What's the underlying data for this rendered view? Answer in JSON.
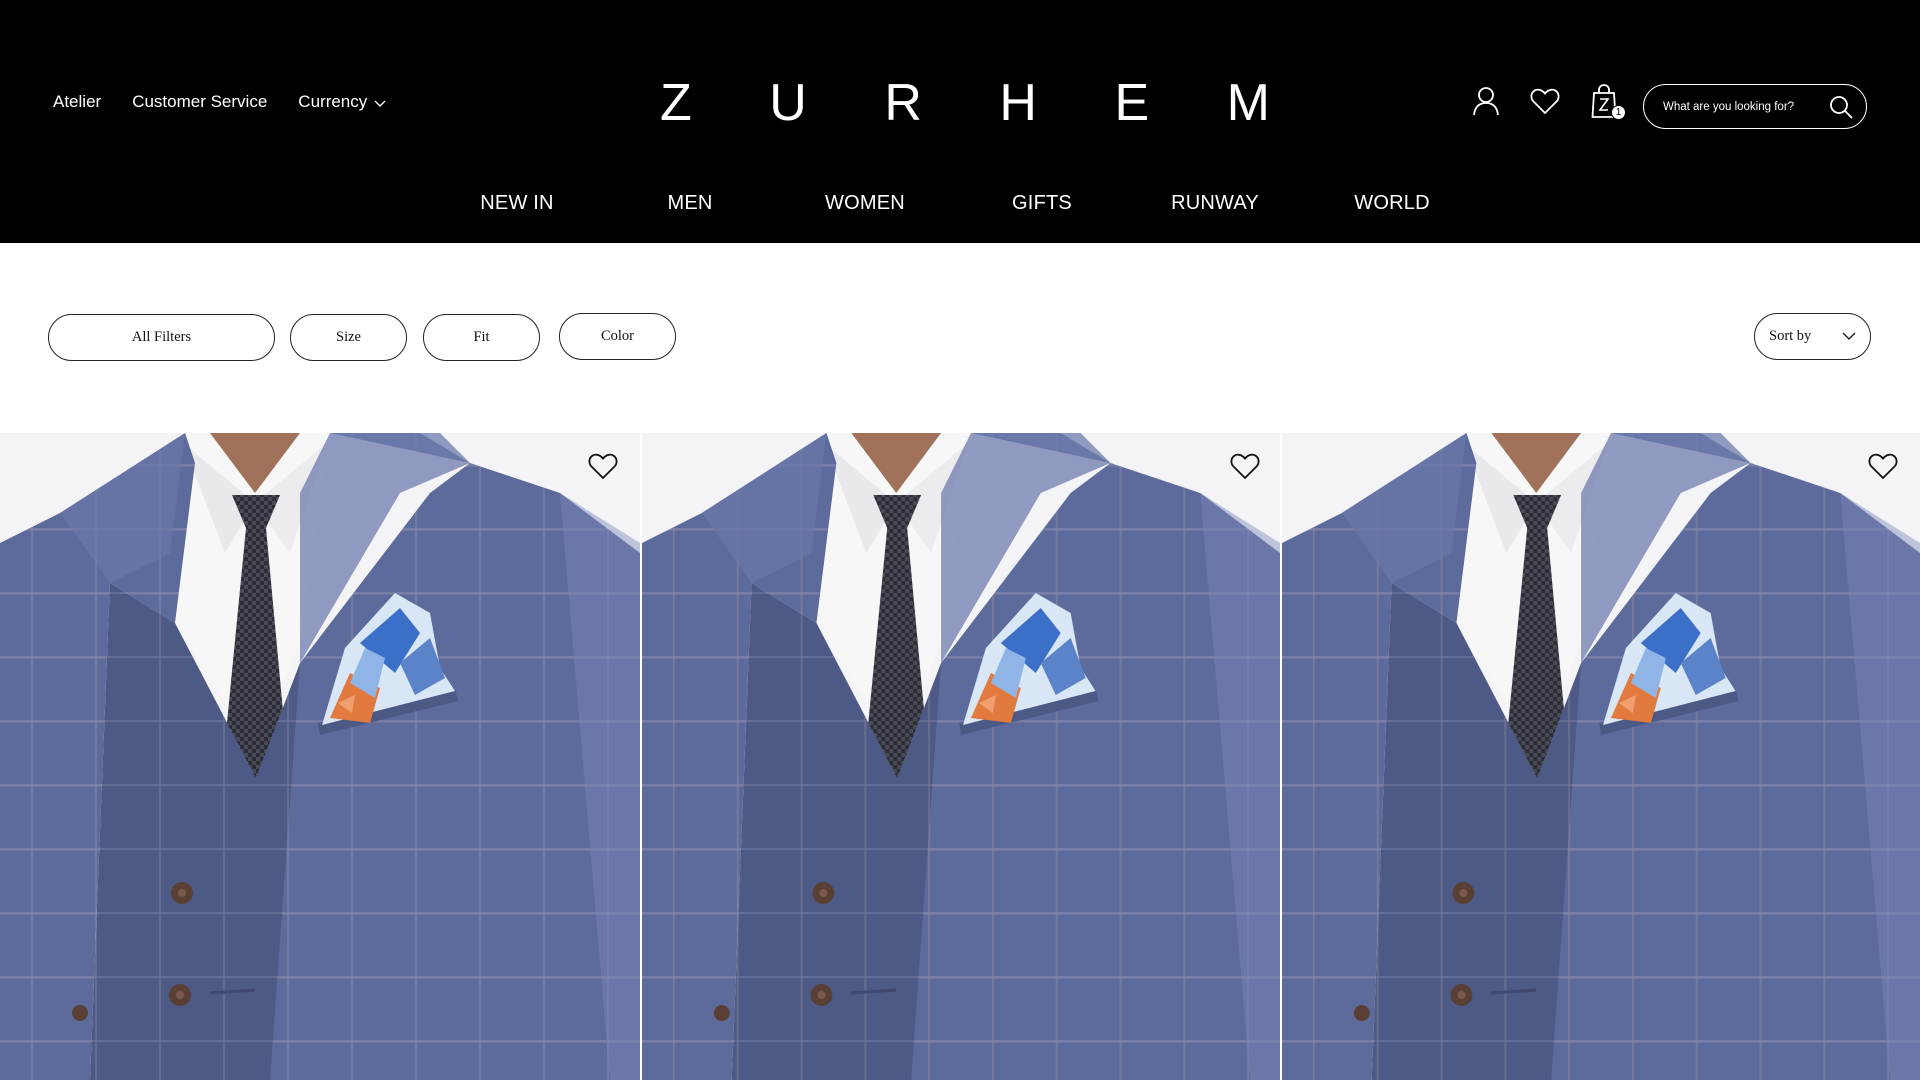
{
  "header": {
    "utility_links": [
      "Atelier",
      "Customer Service",
      "Currency"
    ],
    "logo_letters": [
      "Z",
      "U",
      "R",
      "H",
      "E",
      "M"
    ],
    "icons": {
      "account": "user-icon",
      "wishlist": "heart-icon",
      "cart": "shopping-bag-icon",
      "search": "search-icon"
    },
    "cart_count": "1",
    "search_placeholder": "What are you looking for?"
  },
  "main_nav": [
    "NEW IN",
    "MEN",
    "WOMEN",
    "GIFTS",
    "RUNWAY",
    "WORLD"
  ],
  "filters": {
    "all_filters": "All Filters",
    "size": "Size",
    "fit": "Fit",
    "color": "Color",
    "sort_by": "Sort by"
  },
  "products": [
    {
      "image": "blue check suit with patterned pocket square",
      "wishlist_icon": "heart-outline-icon"
    },
    {
      "image": "blue check suit with patterned pocket square",
      "wishlist_icon": "heart-outline-icon"
    },
    {
      "image": "blue check suit with patterned pocket square",
      "wishlist_icon": "heart-outline-icon"
    }
  ],
  "colors": {
    "header_bg": "#000000",
    "header_text": "#ffffff",
    "suit_blue": "#5b6a9a",
    "page_bg": "#ffffff"
  }
}
